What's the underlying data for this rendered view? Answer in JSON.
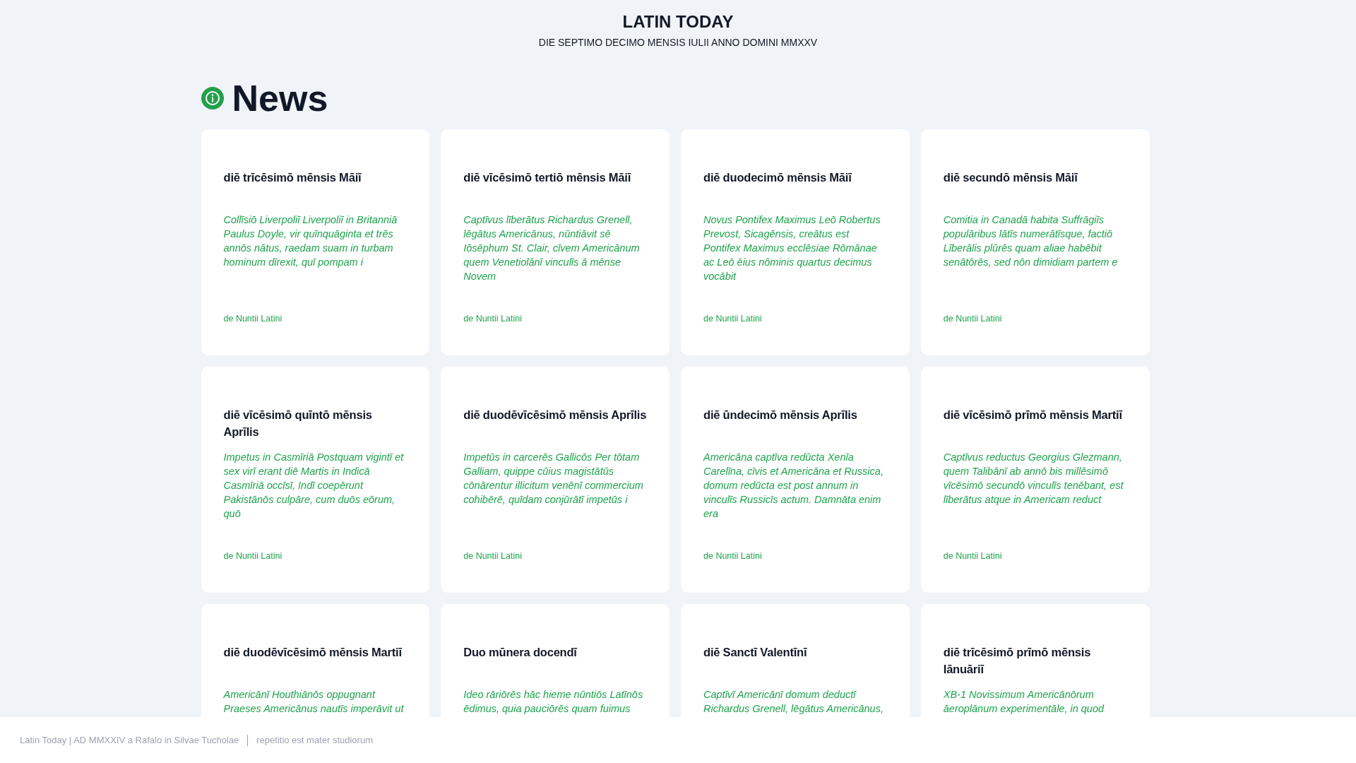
{
  "header": {
    "title": "LATIN TODAY",
    "date": "DIE SEPTIMO DECIMO MENSIS IULII ANNO DOMINI MMXXV"
  },
  "section": {
    "title": "News"
  },
  "articles": [
    {
      "title": "diē trīcēsimō mēnsis Māiī",
      "excerpt": "Collīsiō Liverpoliī Liverpoliī in Britanniā Paulus Doyle, vir quīnquāginta et trēs annōs nātus, raedam suam in turbam hominum dīrexit, quī pompam i",
      "source": "de Nuntii Latini"
    },
    {
      "title": "diē vīcēsimō tertiō mēnsis Māiī",
      "excerpt": "Captīvus līberātus Richardus Grenell, lēgātus Americānus, nūntiāvit sē Iōsēphum St. Clair, cīvem Americānum quem Venetiolānī vinculīs ā mēnse Novem",
      "source": "de Nuntii Latini"
    },
    {
      "title": "diē duodecimō mēnsis Māiī",
      "excerpt": "Novus Pontifex Maximus Leō Robertus Prevost, Sicagēnsis, creātus est Pontifex Maximus ecclēsiae Rōmānae ac Leō ēius nōminis quartus decimus vocābit",
      "source": "de Nuntii Latini"
    },
    {
      "title": "diē secundō mēnsis Māiī",
      "excerpt": "Comitia in Canadā habita Suffrāgiīs populāribus lātīs numerātīsque, factiō Līberālis plūrēs quam aliae habēbit senātōrēs, sed nōn dimidiam partem e",
      "source": "de Nuntii Latini"
    },
    {
      "title": "diē vīcēsimō quīntō mēnsis Aprīlis",
      "excerpt": "Impetus in Casmīriā Postquam vigintī et sex virī erant diē Martis in Indicā Casmīriā occīsī, Indī coepērunt Pakistānōs culpāre, cum duōs eōrum, quō",
      "source": "de Nuntii Latini"
    },
    {
      "title": "diē duodēvīcēsimō mēnsis Aprīlis",
      "excerpt": "Impetūs in carcerēs Gallicōs Per tōtam Galliam, quippe cūius magistātūs cōnārentur illicitum venēnī commercium cohibērē, quīdam conjūrātī impetūs i",
      "source": "de Nuntii Latini"
    },
    {
      "title": "diē ūndecimō mēnsis Aprīlis",
      "excerpt": "Americāna captīva redūcta Xenīa Carelīna, cīvis et Americāna et Russica, domum redūcta est post annum in vinculīs Russicīs actum.  Damnāta enim era",
      "source": "de Nuntii Latini"
    },
    {
      "title": "diē vīcēsimō prīmō mēnsis Martiī",
      "excerpt": "Captīvus reductus Georgius Glezmann, quem Talibānī ab annō bis millēsimō vīcēsimō secundō vinculīs tenēbant, est līberātus atque in Americam reduct",
      "source": "de Nuntii Latini"
    },
    {
      "title": "diē duodēvīcēsimō mēnsis Martiī",
      "excerpt": "Americānī Houthiānōs oppugnant Praeses Americānus nautīs imperāvit ut"
    },
    {
      "title": "Duo mūnera docendī",
      "excerpt": "Ideo rāriōrēs hāc hieme nūntiōs Latīnōs ēdimus, quia pauciōrēs quam fuimus"
    },
    {
      "title": "diē Sanctī Valentīnī",
      "excerpt": "Captīvī Americānī domum deductī Richardus Grenell, lēgātus Americānus,"
    },
    {
      "title": "diē trīcēsimō prīmō mēnsis Iānuāriī",
      "excerpt": "XB-1 Novissimum Americānōrum āeroplānum experimentāle, in quod"
    }
  ],
  "footer": {
    "credit": "Latin Today | AD MMXXIV a Rafalo in Silvae Tucholae",
    "motto": "repetitio est mater studiorum"
  }
}
